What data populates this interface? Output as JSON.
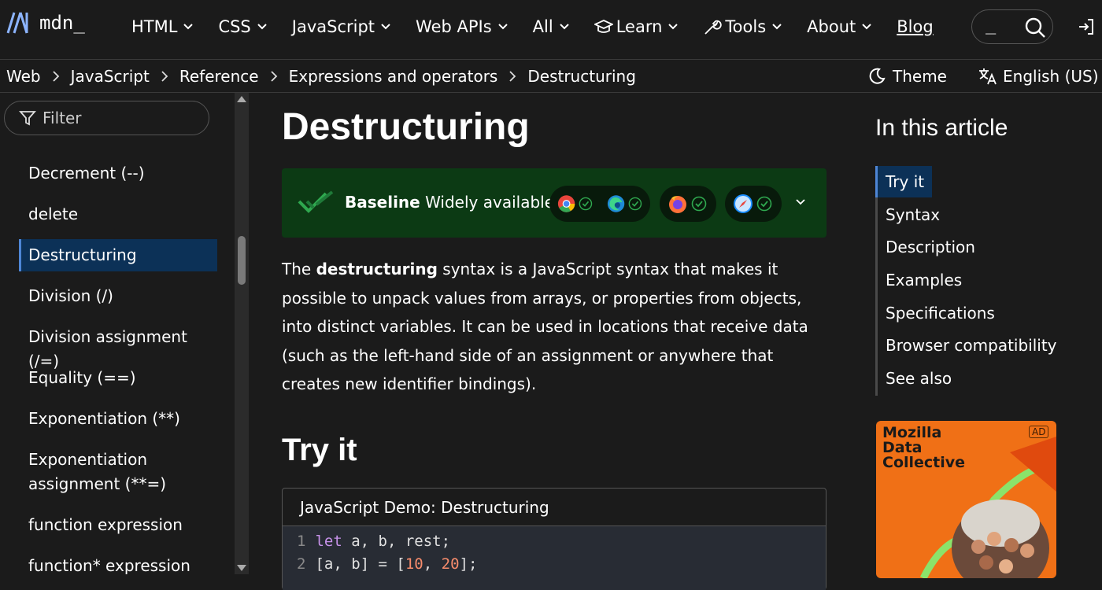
{
  "header": {
    "logo_text": "mdn_",
    "nav": [
      {
        "label": "HTML"
      },
      {
        "label": "CSS"
      },
      {
        "label": "JavaScript"
      },
      {
        "label": "Web APIs"
      },
      {
        "label": "All"
      },
      {
        "label": "Learn"
      },
      {
        "label": "Tools"
      },
      {
        "label": "About"
      }
    ],
    "blog_label": "Blog",
    "search_placeholder": "_"
  },
  "breadcrumb": {
    "items": [
      "Web",
      "JavaScript",
      "Reference",
      "Expressions and operators",
      "Destructuring"
    ],
    "theme_label": "Theme",
    "language_label": "English (US)"
  },
  "sidebar": {
    "filter_placeholder": "Filter",
    "items": [
      {
        "label": "Decrement (--)"
      },
      {
        "label": "delete"
      },
      {
        "label": "Destructuring",
        "active": true
      },
      {
        "label": "Division (/)"
      },
      {
        "label": "Division assignment (/=)"
      },
      {
        "label": "Equality (==)"
      },
      {
        "label": "Exponentiation (**)"
      },
      {
        "label": "Exponentiation assignment (**=)"
      },
      {
        "label": "function expression"
      },
      {
        "label": "function* expression"
      }
    ]
  },
  "main": {
    "title": "Destructuring",
    "baseline": {
      "strong": "Baseline",
      "status": "Widely available",
      "browsers": [
        "chrome-icon",
        "edge-icon",
        "firefox-icon",
        "safari-icon"
      ]
    },
    "intro": {
      "pre": "The ",
      "bold": "destructuring",
      "post": " syntax is a JavaScript syntax that makes it possible to unpack values from arrays, or properties from objects, into distinct variables. It can be used in locations that receive data (such as the left-hand side of an assignment or anywhere that creates new identifier bindings)."
    },
    "try_it_heading": "Try it",
    "demo": {
      "title": "JavaScript Demo: Destructuring",
      "lines": [
        {
          "n": "1",
          "kw": "let",
          "rest": " a, b, rest;"
        },
        {
          "n": "2",
          "a": "[a, b] = [",
          "n1": "10",
          "mid": ", ",
          "n2": "20",
          "end": "];"
        }
      ]
    }
  },
  "toc": {
    "title": "In this article",
    "items": [
      {
        "label": "Try it",
        "active": true
      },
      {
        "label": "Syntax"
      },
      {
        "label": "Description"
      },
      {
        "label": "Examples"
      },
      {
        "label": "Specifications"
      },
      {
        "label": "Browser compatibility"
      },
      {
        "label": "See also"
      }
    ]
  },
  "ad": {
    "title": "Mozilla\nData\nCollective",
    "badge": "AD"
  },
  "colors": {
    "accent": "#8cb4ff",
    "active_bg": "#0c3157",
    "baseline_bg": "#0c3a14",
    "ad_bg": "#f07016"
  }
}
